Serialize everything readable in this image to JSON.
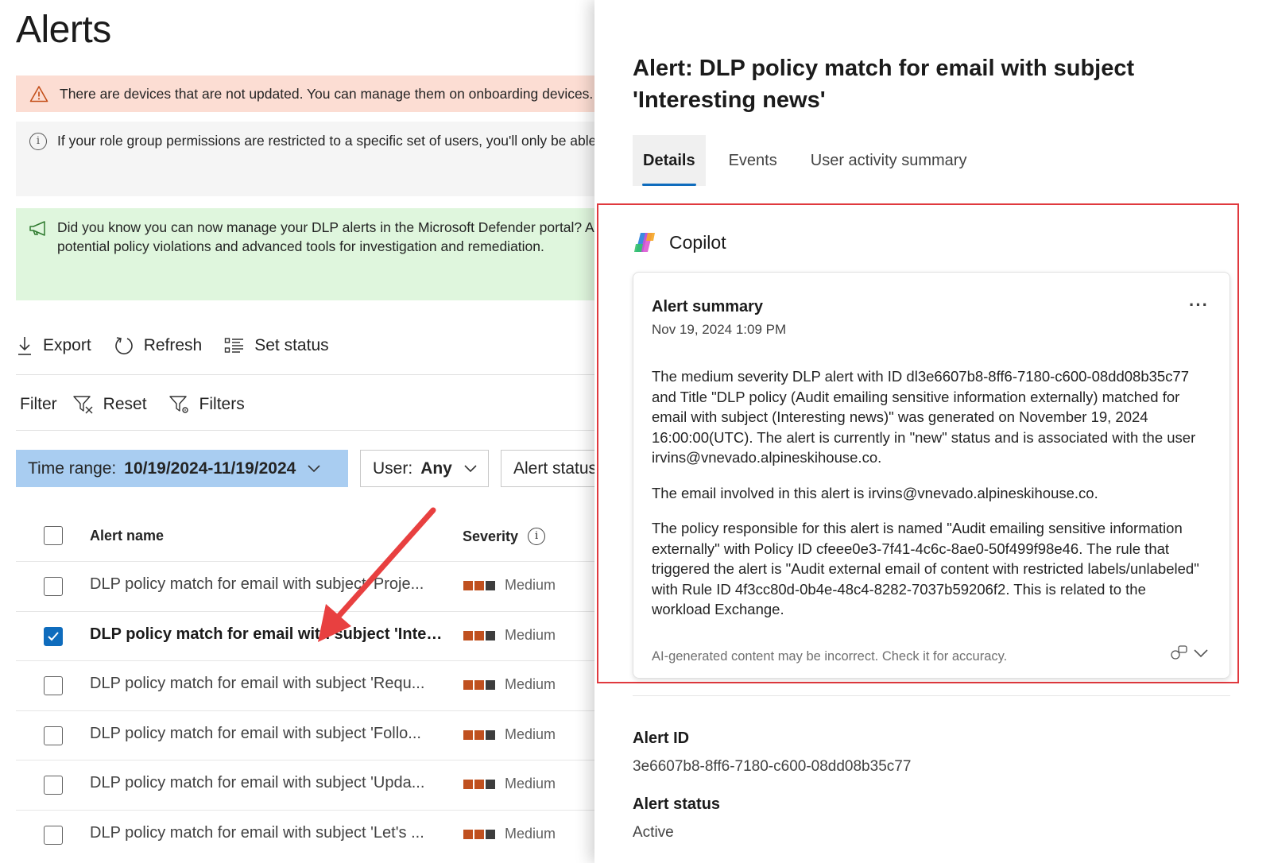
{
  "page": {
    "title": "Alerts"
  },
  "banners": {
    "warning": "There are devices that are not updated. You can manage them on onboarding devices.",
    "info": "If your role group permissions are restricted to a specific set of users, you'll only be able",
    "promo_line1": "Did you know you can now manage your DLP alerts in the Microsoft Defender portal? A",
    "promo_line2": "potential policy violations and advanced tools for investigation and remediation."
  },
  "toolbar": {
    "export": "Export",
    "refresh": "Refresh",
    "set_status": "Set status"
  },
  "filterbar": {
    "label": "Filter",
    "reset": "Reset",
    "filters": "Filters"
  },
  "filters": {
    "time_range_label": "Time range:",
    "time_range_value": "10/19/2024-11/19/2024",
    "user_label": "User:",
    "user_value": "Any",
    "alert_status_label": "Alert status"
  },
  "table": {
    "headers": {
      "name": "Alert name",
      "severity": "Severity"
    },
    "rows": [
      {
        "name": "DLP policy match for email with subject 'Proje...",
        "severity": "Medium",
        "checked": false
      },
      {
        "name": "DLP policy match for email with subject 'Inter...",
        "severity": "Medium",
        "checked": true
      },
      {
        "name": "DLP policy match for email with subject 'Requ...",
        "severity": "Medium",
        "checked": false
      },
      {
        "name": "DLP policy match for email with subject 'Follo...",
        "severity": "Medium",
        "checked": false
      },
      {
        "name": "DLP policy match for email with subject 'Upda...",
        "severity": "Medium",
        "checked": false
      },
      {
        "name": "DLP policy match for email with subject 'Let's ...",
        "severity": "Medium",
        "checked": false
      }
    ]
  },
  "panel": {
    "title": "Alert: DLP policy match for email with subject 'Interesting news'",
    "tabs": [
      "Details",
      "Events",
      "User activity summary"
    ],
    "copilot": {
      "label": "Copilot",
      "card_title": "Alert summary",
      "card_date": "Nov 19, 2024 1:09 PM",
      "paragraphs": [
        "The medium severity DLP alert with ID dl3e6607b8-8ff6-7180-c600-08dd08b35c77 and Title \"DLP policy (Audit emailing sensitive information externally) matched for email with subject (Interesting news)\" was generated on November 19, 2024 16:00:00(UTC). The alert is currently in \"new\" status and is associated with the user irvins@vnevado.alpineskihouse.co.",
        "The email involved in this alert is irvins@vnevado.alpineskihouse.co.",
        "The policy responsible for this alert is named \"Audit emailing sensitive information externally\" with Policy ID cfeee0e3-7f41-4c6c-8ae0-50f499f98e46. The rule that triggered the alert is \"Audit external email of content with restricted labels/unlabeled\" with Rule ID 4f3cc80d-0b4e-48c4-8282-7037b59206f2. This is related to the workload Exchange."
      ],
      "disclaimer": "AI-generated content may be incorrect. Check it for accuracy."
    },
    "fields": {
      "alert_id_label": "Alert ID",
      "alert_id_value": "3e6607b8-8ff6-7180-c600-08dd08b35c77",
      "alert_status_label": "Alert status",
      "alert_status_value": "Active"
    }
  },
  "colors": {
    "accent": "#0f6cbd",
    "severity_bar": "#c0501f",
    "severity_bar_dark": "#3d3d3d",
    "highlight_box": "#e0393e",
    "annotation_arrow": "#e84040"
  }
}
